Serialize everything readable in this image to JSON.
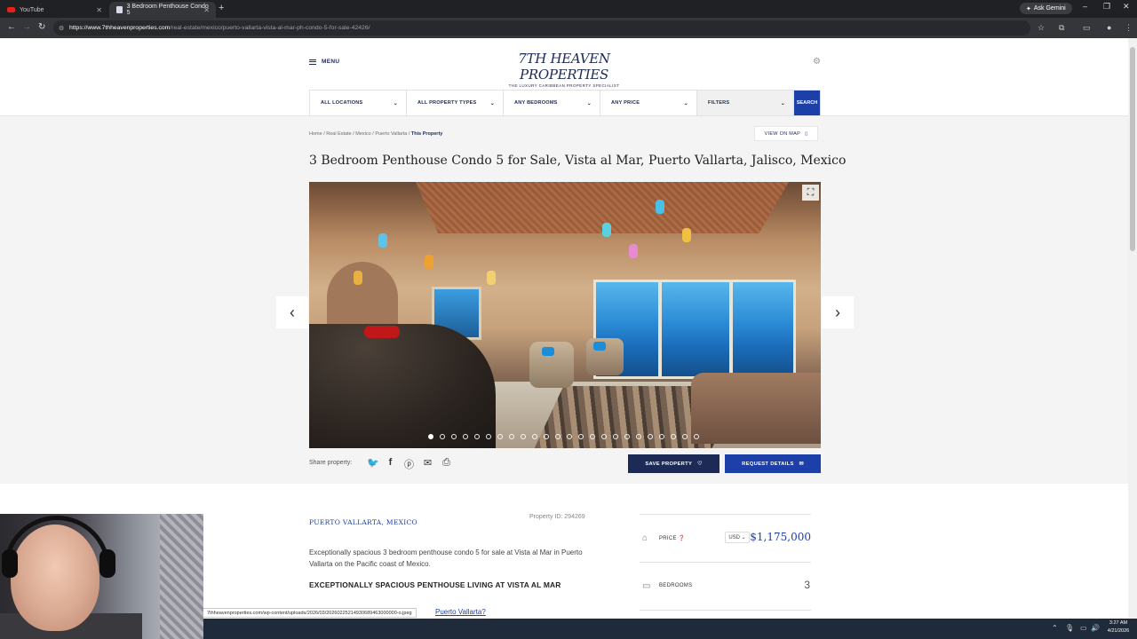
{
  "browser": {
    "tabs": [
      {
        "title": "YouTube"
      },
      {
        "title": "3 Bedroom Penthouse Condo 5"
      }
    ],
    "url_host": "https://www.7thheavenproperties.com",
    "url_path": "/real-estate/mexico/puerto-vallarta-vista-al-mar-ph-condo-5-for-sale-42426/",
    "gemini_label": "Ask Gemini"
  },
  "header": {
    "menu_label": "MENU",
    "logo_text": "7TH HEAVEN PROPERTIES",
    "logo_tagline": "THE LUXURY CARIBBEAN PROPERTY SPECIALIST"
  },
  "filters": {
    "locations": "ALL LOCATIONS",
    "types": "ALL PROPERTY TYPES",
    "bedrooms": "ANY BEDROOMS",
    "price": "ANY PRICE",
    "filters": "FILTERS",
    "search": "SEARCH"
  },
  "breadcrumb": {
    "home": "Home",
    "real_estate": "Real Estate",
    "country": "Mexico",
    "city": "Puerto Vallarta",
    "current": "This Property",
    "view_map": "VIEW ON MAP"
  },
  "property": {
    "title": "3 Bedroom Penthouse Condo 5 for Sale, Vista al Mar, Puerto Vallarta, Jalisco, Mexico",
    "location": "PUERTO VALLARTA, MEXICO",
    "property_id": "Property ID: 294269",
    "description": "Exceptionally spacious 3 bedroom penthouse condo 5 for sale at Vista al Mar in Puerto Vallarta on the Pacific coast of Mexico.",
    "subheading": "EXCEPTIONALLY SPACIOUS PENTHOUSE LIVING AT VISTA AL MAR",
    "link_fragment": "Puerto Vallarta",
    "link_suffix": "?"
  },
  "gallery": {
    "slide_count": 24,
    "active_slide": 1
  },
  "share": {
    "label": "Share property:",
    "save_label": "SAVE PROPERTY",
    "request_label": "REQUEST DETAILS"
  },
  "facts": {
    "price_label": "PRICE",
    "currency": "USD",
    "price_value": "$1,175,000",
    "bedrooms_label": "BEDROOMS",
    "bedrooms_value": "3"
  },
  "status_bar": "7thheavenproperties.com/wp-content/uploads/2026/03/20260225214930689463000000-o.jpeg",
  "clock": {
    "time": "3:27 AM",
    "date": "4/21/2026"
  },
  "colors": {
    "navy": "#1d2a55",
    "accent_blue": "#1c3fa8"
  }
}
